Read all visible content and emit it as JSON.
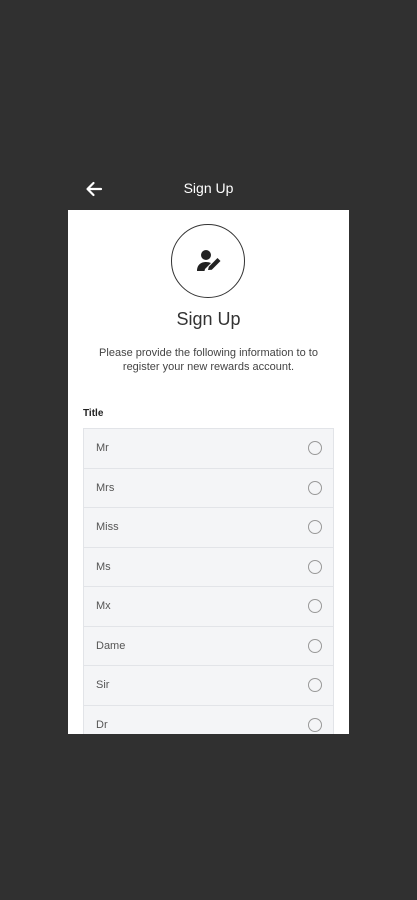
{
  "header": {
    "title": "Sign Up",
    "back_icon": "arrow-left-icon"
  },
  "card": {
    "avatar_icon": "user-edit-icon",
    "title": "Sign Up",
    "description": "Please provide the following information to to register your new rewards account."
  },
  "title_field": {
    "label": "Title",
    "options": [
      {
        "label": "Mr",
        "selected": false
      },
      {
        "label": "Mrs",
        "selected": false
      },
      {
        "label": "Miss",
        "selected": false
      },
      {
        "label": "Ms",
        "selected": false
      },
      {
        "label": "Mx",
        "selected": false
      },
      {
        "label": "Dame",
        "selected": false
      },
      {
        "label": "Sir",
        "selected": false
      },
      {
        "label": "Dr",
        "selected": false
      }
    ]
  },
  "colors": {
    "background": "#303030",
    "card": "#ffffff",
    "option_bg": "#f4f5f7"
  }
}
